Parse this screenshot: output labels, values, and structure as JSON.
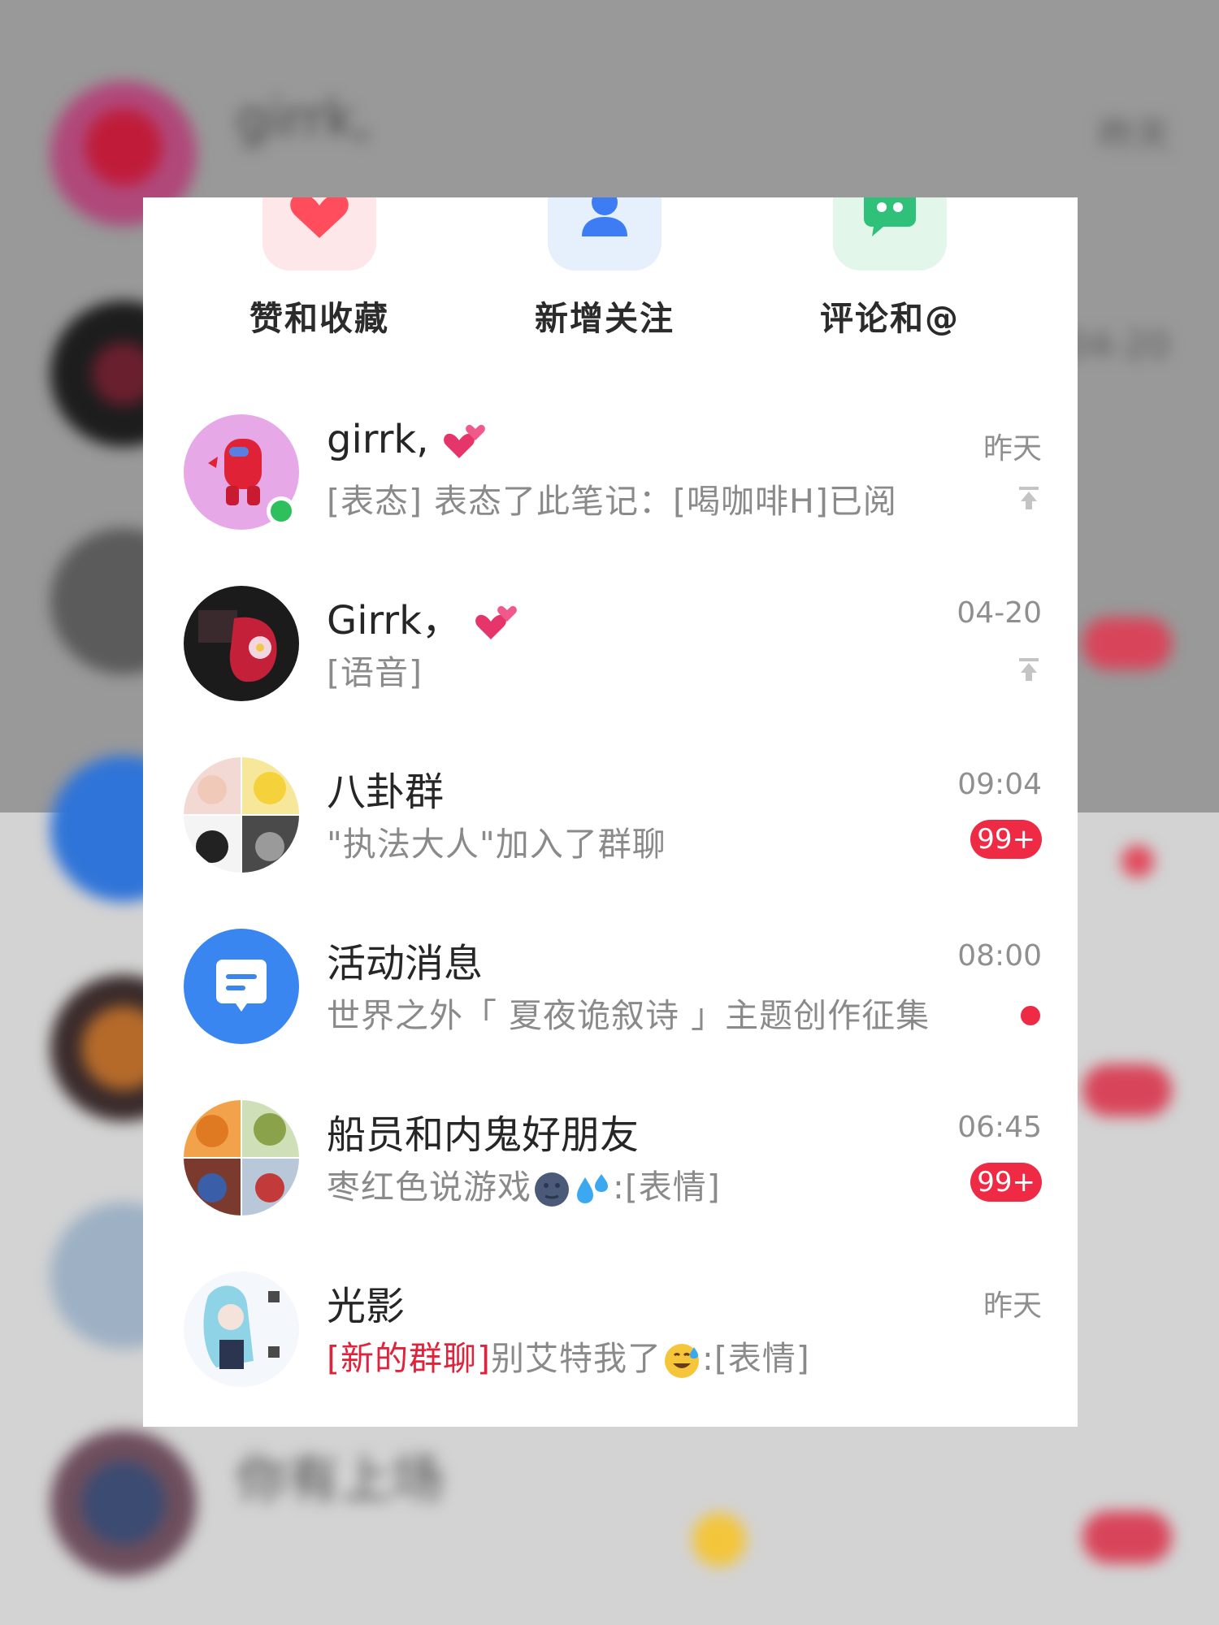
{
  "background": {
    "rows": [
      {
        "title": "girrk,",
        "time": "昨天"
      },
      {
        "title": "",
        "time": "04-20"
      },
      {
        "title": "",
        "time": ""
      },
      {
        "title": "",
        "time": ""
      },
      {
        "title": "",
        "time": ""
      },
      {
        "title": "",
        "time": ""
      },
      {
        "title": "你有上场",
        "time": ""
      }
    ]
  },
  "shortcuts": [
    {
      "label": "赞和收藏",
      "icon": "heart-icon",
      "color": "#ff4d5e",
      "tile": "#fde7e8"
    },
    {
      "label": "新增关注",
      "icon": "person-icon",
      "color": "#3d7cf2",
      "tile": "#e6effc"
    },
    {
      "label": "评论和@",
      "icon": "chat-bubble-icon",
      "color": "#2fc07a",
      "tile": "#e2f6ea"
    }
  ],
  "conversations": [
    {
      "title": "girrk,",
      "title_emoji": "two-hearts-icon",
      "preview": "[表态] 表态了此笔记：[喝咖啡H]已阅",
      "time": "昨天",
      "pinned": true,
      "online": true
    },
    {
      "title": "Girrk，",
      "title_emoji": "two-hearts-icon",
      "preview": "[语音]",
      "time": "04-20",
      "pinned": true
    },
    {
      "title": "八卦群",
      "preview": "\"执法大人\"加入了群聊",
      "time": "09:04",
      "badge": "99+"
    },
    {
      "title": "活动消息",
      "preview": "世界之外「 夏夜诡叙诗 」主题创作征集",
      "time": "08:00",
      "dot": true
    },
    {
      "title": "船员和内鬼好朋友",
      "preview_prefix": "枣红色说游戏",
      "preview_emojis": [
        "moon-face-icon",
        "sweat-droplets-icon"
      ],
      "preview_suffix": ":[表情]",
      "time": "06:45",
      "badge": "99+"
    },
    {
      "title": "光影",
      "preview_tag": "[新的群聊]",
      "preview_prefix": "别艾特我了",
      "preview_emojis": [
        "grinning-sweat-icon"
      ],
      "preview_suffix": ":[表情]",
      "time": "昨天"
    }
  ],
  "colors": {
    "accent_red": "#ee2a45",
    "tag_red": "#e0233c",
    "online_green": "#2ec05c",
    "activity_blue": "#3a86f0"
  }
}
